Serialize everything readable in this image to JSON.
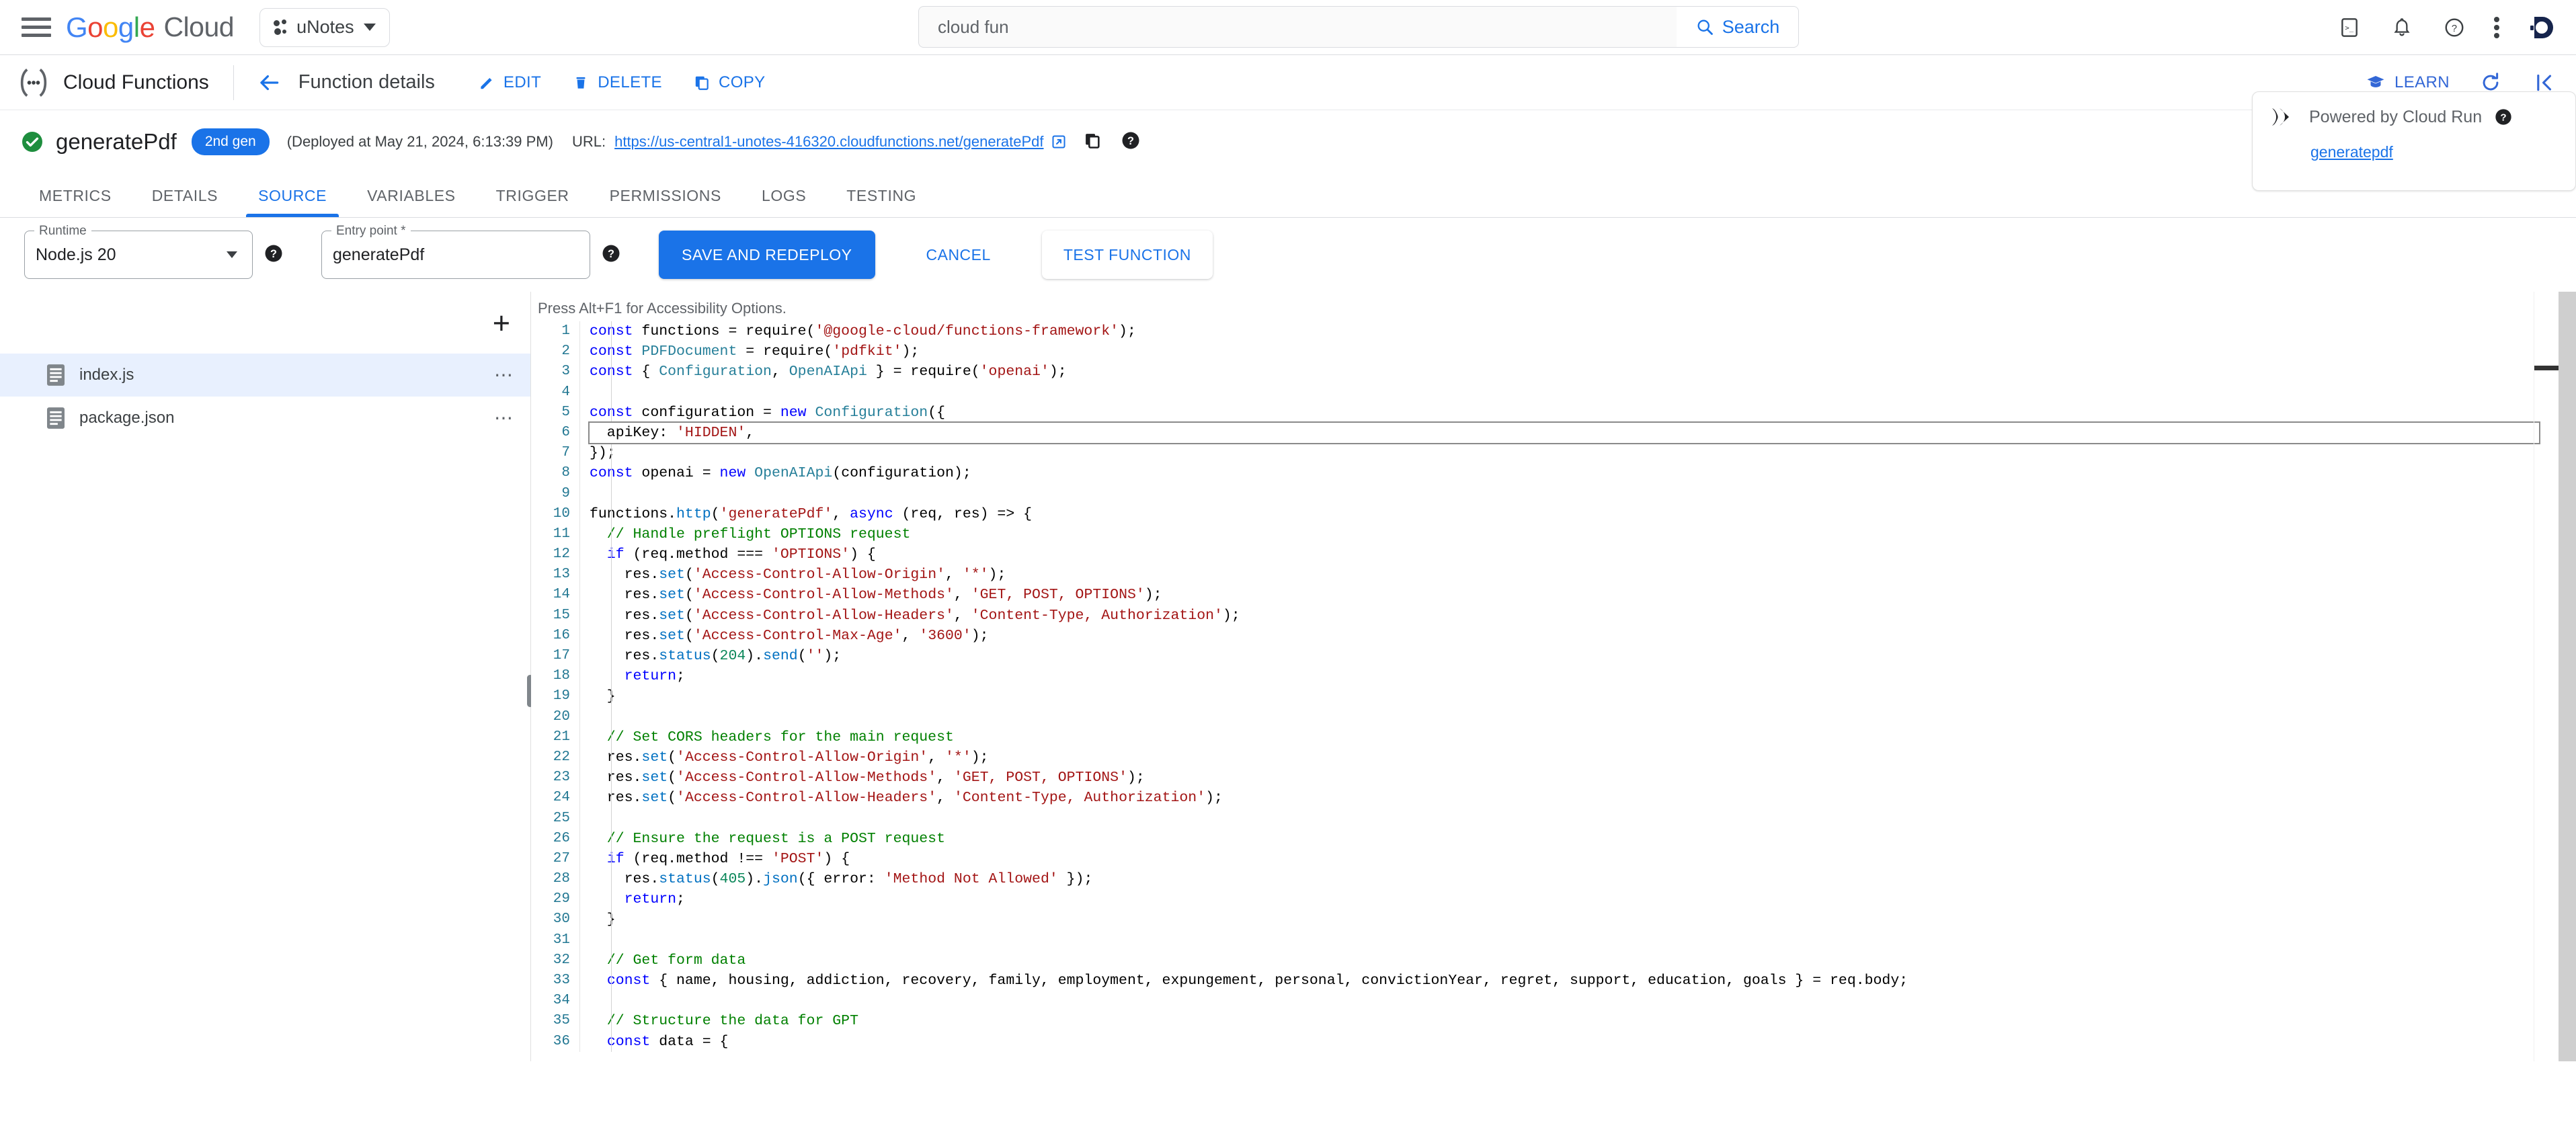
{
  "topbar": {
    "menu_icon": "hamburger-icon",
    "logo_text": "Google Cloud",
    "logo_parts": [
      "G",
      "o",
      "o",
      "g",
      "l",
      "e"
    ],
    "project_name": "uNotes",
    "search_value": "cloud fun",
    "search_placeholder": "Search",
    "search_button_label": "Search",
    "icons": [
      "cloud-shell-icon",
      "notifications-icon",
      "help-icon",
      "more-options-icon",
      "account-avatar"
    ]
  },
  "pagebar": {
    "product_title": "Cloud Functions",
    "page_title": "Function details",
    "back_label": "back-arrow",
    "actions": [
      {
        "label": "EDIT",
        "icon": "pencil-icon"
      },
      {
        "label": "DELETE",
        "icon": "trash-icon"
      },
      {
        "label": "COPY",
        "icon": "copy-icon"
      }
    ],
    "learn_label": "LEARN",
    "refresh_icon": "refresh-icon",
    "collapse_icon": "collapse-panel-icon"
  },
  "function_header": {
    "status_icon": "check-circle-icon",
    "name": "generatePdf",
    "generation_badge": "2nd gen",
    "deployed_text": "(Deployed at May 21, 2024, 6:13:39 PM)",
    "url_label": "URL:",
    "url": "https://us-central1-unotes-416320.cloudfunctions.net/generatePdf",
    "external_icon": "open-in-new-icon",
    "copy_icon": "copy-icon",
    "help_icon": "help-icon"
  },
  "cloud_run_card": {
    "icon": "cloud-run-chevrons-icon",
    "title": "Powered by Cloud Run",
    "help_icon": "help-icon",
    "service_link": "generatepdf"
  },
  "tabs": [
    {
      "label": "METRICS",
      "active": false
    },
    {
      "label": "DETAILS",
      "active": false
    },
    {
      "label": "SOURCE",
      "active": true
    },
    {
      "label": "VARIABLES",
      "active": false
    },
    {
      "label": "TRIGGER",
      "active": false
    },
    {
      "label": "PERMISSIONS",
      "active": false
    },
    {
      "label": "LOGS",
      "active": false
    },
    {
      "label": "TESTING",
      "active": false
    }
  ],
  "controls": {
    "runtime_label": "Runtime",
    "runtime_value": "Node.js 20",
    "entry_point_label": "Entry point *",
    "entry_point_value": "generatePdf",
    "save_label": "SAVE AND REDEPLOY",
    "cancel_label": "CANCEL",
    "test_label": "TEST FUNCTION",
    "primary_color": "#1a73e8"
  },
  "file_tree": {
    "add_label": "+",
    "files": [
      {
        "name": "index.js",
        "selected": true,
        "more": "⋯"
      },
      {
        "name": "package.json",
        "selected": false,
        "more": "⋯"
      }
    ]
  },
  "editor": {
    "a11y_hint": "Press Alt+F1 for Accessibility Options.",
    "highlighted_line": 6,
    "first_line": 1,
    "last_line": 36,
    "lines": [
      "const functions = require('@google-cloud/functions-framework');",
      "const PDFDocument = require('pdfkit');",
      "const { Configuration, OpenAIApi } = require('openai');",
      "",
      "const configuration = new Configuration({",
      "  apiKey: 'HIDDEN',",
      "});",
      "const openai = new OpenAIApi(configuration);",
      "",
      "functions.http('generatePdf', async (req, res) => {",
      "  // Handle preflight OPTIONS request",
      "  if (req.method === 'OPTIONS') {",
      "    res.set('Access-Control-Allow-Origin', '*');",
      "    res.set('Access-Control-Allow-Methods', 'GET, POST, OPTIONS');",
      "    res.set('Access-Control-Allow-Headers', 'Content-Type, Authorization');",
      "    res.set('Access-Control-Max-Age', '3600');",
      "    res.status(204).send('');",
      "    return;",
      "  }",
      "",
      "  // Set CORS headers for the main request",
      "  res.set('Access-Control-Allow-Origin', '*');",
      "  res.set('Access-Control-Allow-Methods', 'GET, POST, OPTIONS');",
      "  res.set('Access-Control-Allow-Headers', 'Content-Type, Authorization');",
      "",
      "  // Ensure the request is a POST request",
      "  if (req.method !== 'POST') {",
      "    res.status(405).json({ error: 'Method Not Allowed' });",
      "    return;",
      "  }",
      "",
      "  // Get form data",
      "  const { name, housing, addiction, recovery, family, employment, expungement, personal, convictionYear, regret, support, education, goals } = req.body;",
      "",
      "  // Structure the data for GPT",
      "  const data = {"
    ]
  }
}
